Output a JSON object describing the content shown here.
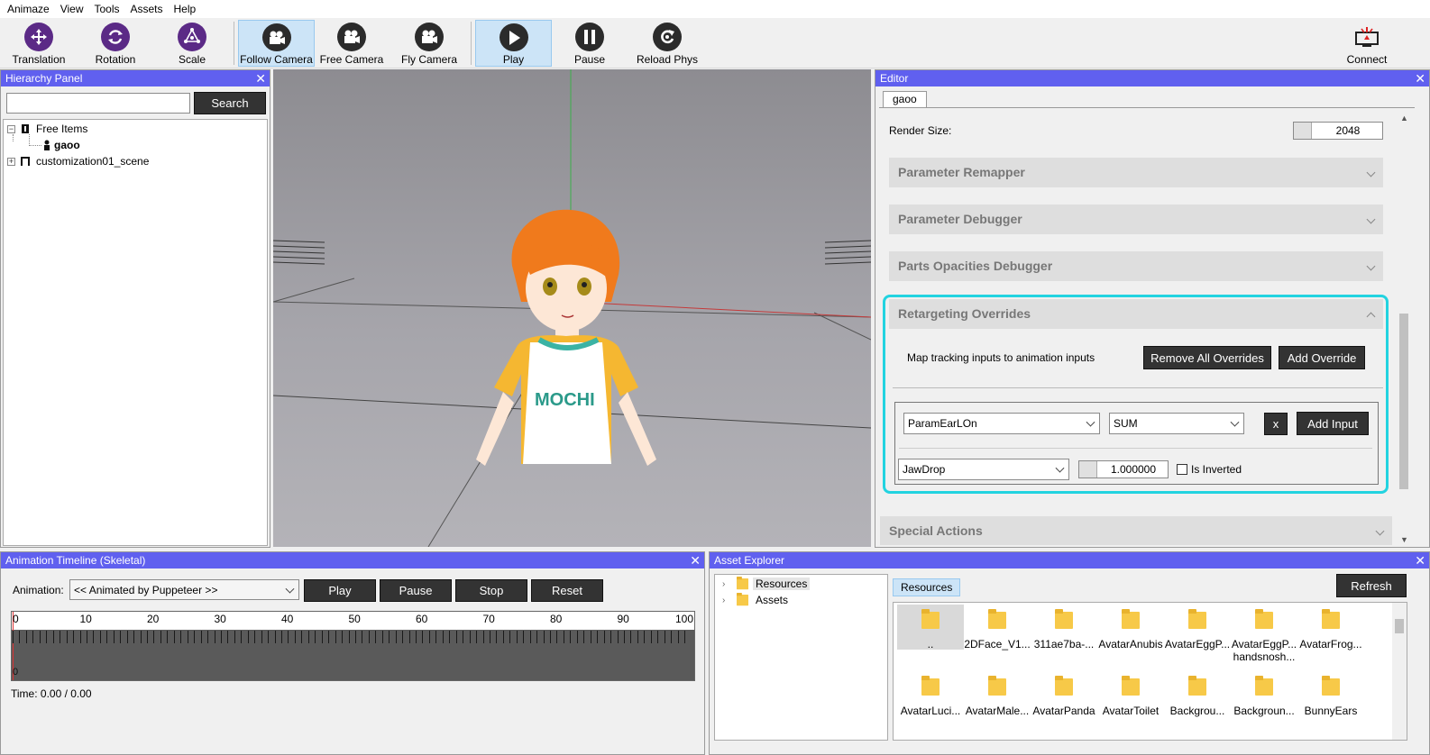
{
  "menu": [
    "Animaze",
    "View",
    "Tools",
    "Assets",
    "Help"
  ],
  "toolbar": {
    "translation": "Translation",
    "rotation": "Rotation",
    "scale": "Scale",
    "follow_camera": "Follow Camera",
    "free_camera": "Free Camera",
    "fly_camera": "Fly Camera",
    "play": "Play",
    "pause": "Pause",
    "reload_phys": "Reload Phys",
    "connect": "Connect"
  },
  "hierarchy": {
    "title": "Hierarchy Panel",
    "search_value": "",
    "search_button": "Search",
    "tree": {
      "root": "Free Items",
      "child": "gaoo",
      "scene": "customization01_scene"
    }
  },
  "editor": {
    "title": "Editor",
    "tab": "gaoo",
    "render_size_label": "Render Size:",
    "render_size_value": "2048",
    "sections": {
      "remapper": "Parameter Remapper",
      "debugger": "Parameter Debugger",
      "opacities": "Parts Opacities Debugger",
      "retargeting": "Retargeting Overrides",
      "special": "Special Actions"
    },
    "retargeting": {
      "description": "Map tracking inputs to animation inputs",
      "remove_all": "Remove All Overrides",
      "add_override": "Add Override",
      "param": "ParamEarLOn",
      "mode": "SUM",
      "remove_x": "x",
      "add_input": "Add Input",
      "input": "JawDrop",
      "weight": "1.000000",
      "is_inverted_label": "Is Inverted",
      "is_inverted": false
    }
  },
  "timeline": {
    "title": "Animation Timeline (Skeletal)",
    "animation_label": "Animation:",
    "animation_value": "<< Animated by Puppeteer >>",
    "play": "Play",
    "pause": "Pause",
    "stop": "Stop",
    "reset": "Reset",
    "ruler": [
      "0",
      "10",
      "20",
      "30",
      "40",
      "50",
      "60",
      "70",
      "80",
      "90",
      "100"
    ],
    "track_start": "0",
    "time": "Time: 0.00 / 0.00"
  },
  "assets": {
    "title": "Asset Explorer",
    "tree": [
      "Resources",
      "Assets"
    ],
    "breadcrumb": "Resources",
    "refresh": "Refresh",
    "row1": [
      "..",
      "2DFace_V1...",
      "311ae7ba-...",
      "AvatarAnubis",
      "AvatarEggP...",
      "AvatarEggP... handsnosh...",
      "AvatarFrog..."
    ],
    "row2": [
      "AvatarLuci...",
      "AvatarMale...",
      "AvatarPanda",
      "AvatarToilet",
      "Backgrou...",
      "Backgroun...",
      "BunnyEars"
    ]
  },
  "colors": {
    "panel_header": "#6060ef",
    "highlight": "#22d3e0",
    "dark_button": "#333333"
  }
}
